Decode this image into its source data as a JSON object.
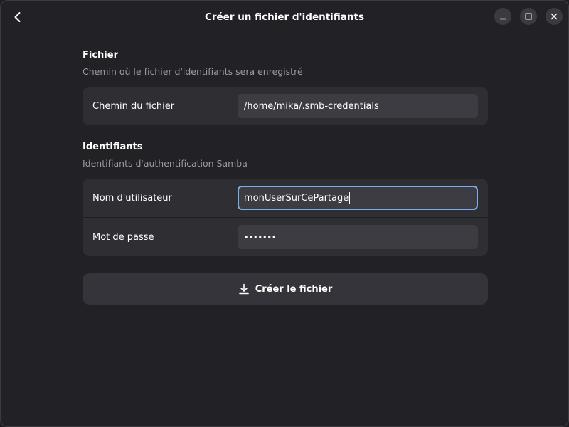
{
  "window": {
    "title": "Créer un fichier d'identifiants"
  },
  "icons": {
    "back": "chevron-left-icon",
    "minimize": "minimize-icon",
    "maximize": "maximize-icon",
    "close": "close-icon",
    "download": "download-icon"
  },
  "file_group": {
    "title": "Fichier",
    "description": "Chemin où le fichier d'identifiants sera enregistré",
    "path_label": "Chemin du fichier",
    "path_value": "/home/mika/.smb-credentials"
  },
  "credentials_group": {
    "title": "Identifiants",
    "description": "Identifiants d'authentification Samba",
    "username_label": "Nom d'utilisateur",
    "username_value": "monUserSurCePartage",
    "password_label": "Mot de passe",
    "password_value": "•••••••"
  },
  "actions": {
    "create_label": "Créer le fichier"
  },
  "colors": {
    "accent_focus": "#78aeed",
    "window_bg": "#222226",
    "row_bg": "#2e2e33"
  }
}
